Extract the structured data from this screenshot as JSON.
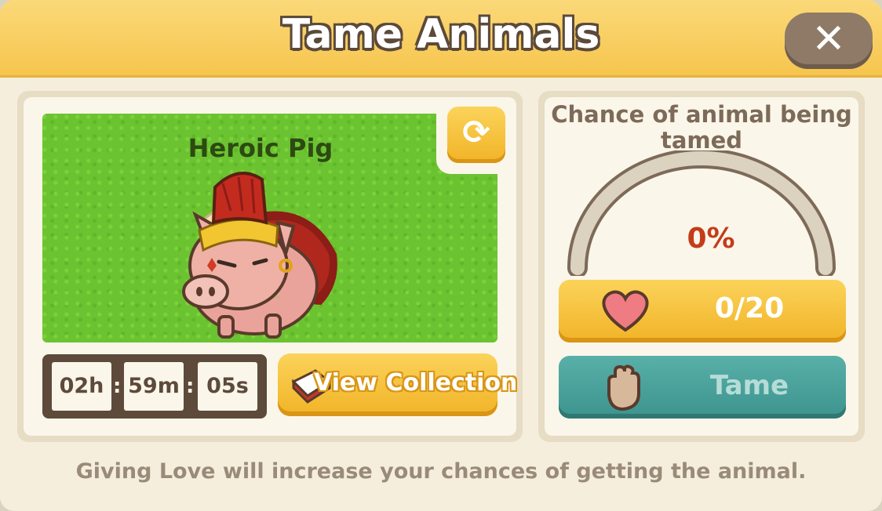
{
  "dialog": {
    "title": "Tame Animals",
    "close_icon": "close-icon"
  },
  "animal": {
    "name": "Heroic Pig",
    "refresh_icon": "refresh-icon"
  },
  "timer": {
    "hours": "02h",
    "minutes": "59m",
    "seconds": "05s",
    "separator": ":"
  },
  "view_collection": {
    "label": "View Collection",
    "icon": "book-icon"
  },
  "chance": {
    "title": "Chance of animal being tamed",
    "percent": "0%",
    "value_fraction": 0
  },
  "love": {
    "count": "0/20",
    "icon": "heart-icon"
  },
  "tame": {
    "label": "Tame",
    "icon": "hand-icon",
    "enabled": false
  },
  "footer": {
    "hint": "Giving Love will increase your chances of getting the animal."
  },
  "colors": {
    "header": "#f6c54e",
    "button_yellow": "#f1b327",
    "button_teal": "#3d938d",
    "percent": "#c43c18",
    "grass": "#6cc331"
  }
}
